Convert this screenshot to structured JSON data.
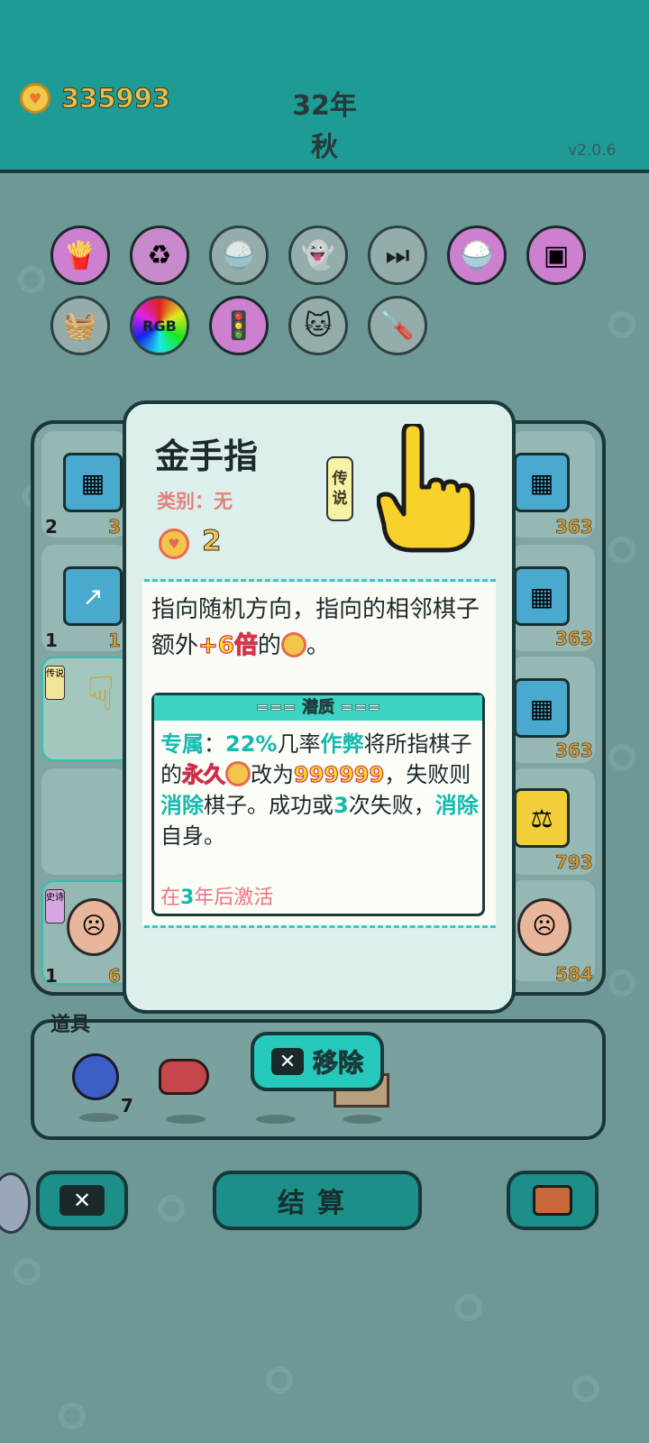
{
  "header": {
    "coins": "335993",
    "year": "32年",
    "season": "秋",
    "version": "v2.0.6"
  },
  "relics": [
    {
      "name": "fries-icon",
      "bg": "#cd7fd0"
    },
    {
      "name": "recycle-icon",
      "bg": "#c98acb"
    },
    {
      "name": "rice-bowl-icon",
      "bg": "#9fb2b0"
    },
    {
      "name": "ghost-icon",
      "bg": "#9fb2b0"
    },
    {
      "name": "skip-icon",
      "bg": "#9fb2b0"
    },
    {
      "name": "rice-bowl-icon",
      "bg": "#cd7fd0"
    },
    {
      "name": "frame-icon",
      "bg": "#cd7fd0"
    },
    {
      "name": "fruit-basket-icon",
      "bg": "#9fb2b0"
    },
    {
      "name": "rgb-icon",
      "bg": "#9fb2b0"
    },
    {
      "name": "traffic-light-icon",
      "bg": "#cd7fd0"
    },
    {
      "name": "cat-faces-icon",
      "bg": "#9fb2b0"
    },
    {
      "name": "screwdriver-icon",
      "bg": "#9fb2b0"
    }
  ],
  "board": {
    "left_counts": [
      "2",
      "1",
      "1"
    ],
    "left_values": [
      "3",
      "1",
      "6"
    ],
    "right_values": [
      "363",
      "363",
      "363",
      "793",
      "584"
    ],
    "tag_legend": "传说",
    "tag_epic": "史诗"
  },
  "popup": {
    "title": "金手指",
    "category": "类别：无",
    "coin_value": "2",
    "rarity_chars": [
      "传",
      "说"
    ],
    "desc_a": "指向随机方向，指向的相邻棋子额外",
    "desc_mult": "+6倍",
    "desc_b": "的",
    "desc_c": "。",
    "potential_title": "=== 潜质 ===",
    "p_exclusive": "专属",
    "p_colon": "：",
    "p_pct": "22%",
    "p_t1": "几率",
    "p_cheat": "作弊",
    "p_t2": "将所指棋子的",
    "p_perm": "永久",
    "p_t3": "改为",
    "p_num": "999999",
    "p_t4": "，失败则",
    "p_remove": "消除",
    "p_t5": "棋子。成功或",
    "p_three": "3",
    "p_t6": "次失败，",
    "p_remove2": "消除",
    "p_t7": "自身。",
    "act_a": "在",
    "act_num": "3",
    "act_b": "年后激活"
  },
  "props": {
    "label": "道具",
    "blueberry_count": "7",
    "remove_label": "移除"
  },
  "bottom": {
    "settle_label": "结算"
  },
  "colors": {
    "accent": "#1f9b96",
    "teal_text": "#16b9b0",
    "coin": "#f3c64b"
  }
}
